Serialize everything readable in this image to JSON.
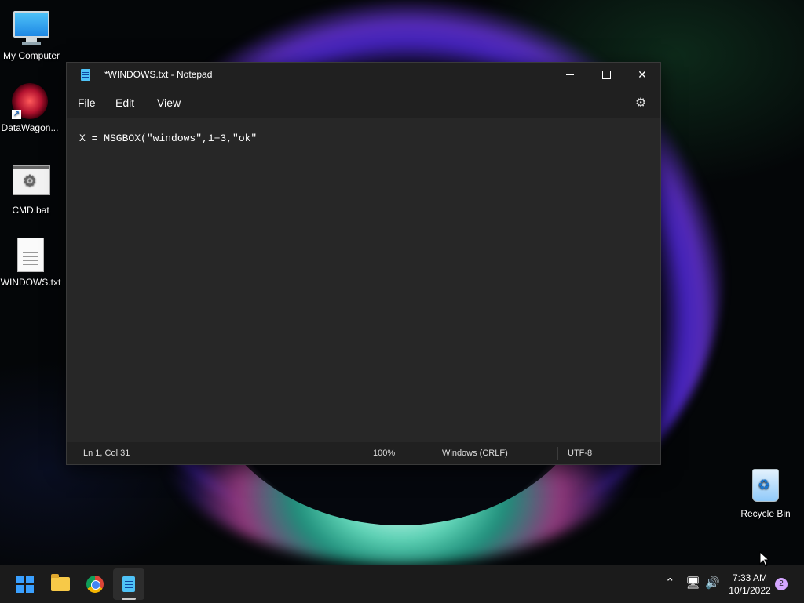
{
  "desktop": {
    "icons": [
      {
        "label": "My Computer",
        "icon": "monitor-icon"
      },
      {
        "label": "DataWagon...",
        "icon": "datawagon-icon"
      },
      {
        "label": "CMD.bat",
        "icon": "batch-file-icon"
      },
      {
        "label": "WINDOWS.txt",
        "icon": "text-file-icon"
      },
      {
        "label": "Recycle Bin",
        "icon": "recycle-bin-icon"
      }
    ]
  },
  "window": {
    "title": "*WINDOWS.txt - Notepad",
    "menu": [
      "File",
      "Edit",
      "View"
    ],
    "content": "X = MSGBOX(\"windows\",1+3,\"ok\"",
    "status": {
      "position": "Ln 1, Col 31",
      "zoom": "100%",
      "line_ending": "Windows (CRLF)",
      "encoding": "UTF-8"
    }
  },
  "taskbar": {
    "apps": [
      "start-icon",
      "file-explorer-icon",
      "chrome-icon",
      "notepad-icon"
    ],
    "tray": {
      "time": "7:33 AM",
      "date": "10/1/2022",
      "notifications": "2"
    }
  },
  "colors": {
    "accent": "#3aa0ff",
    "window_bg": "#202020",
    "editor_bg": "#272727"
  }
}
